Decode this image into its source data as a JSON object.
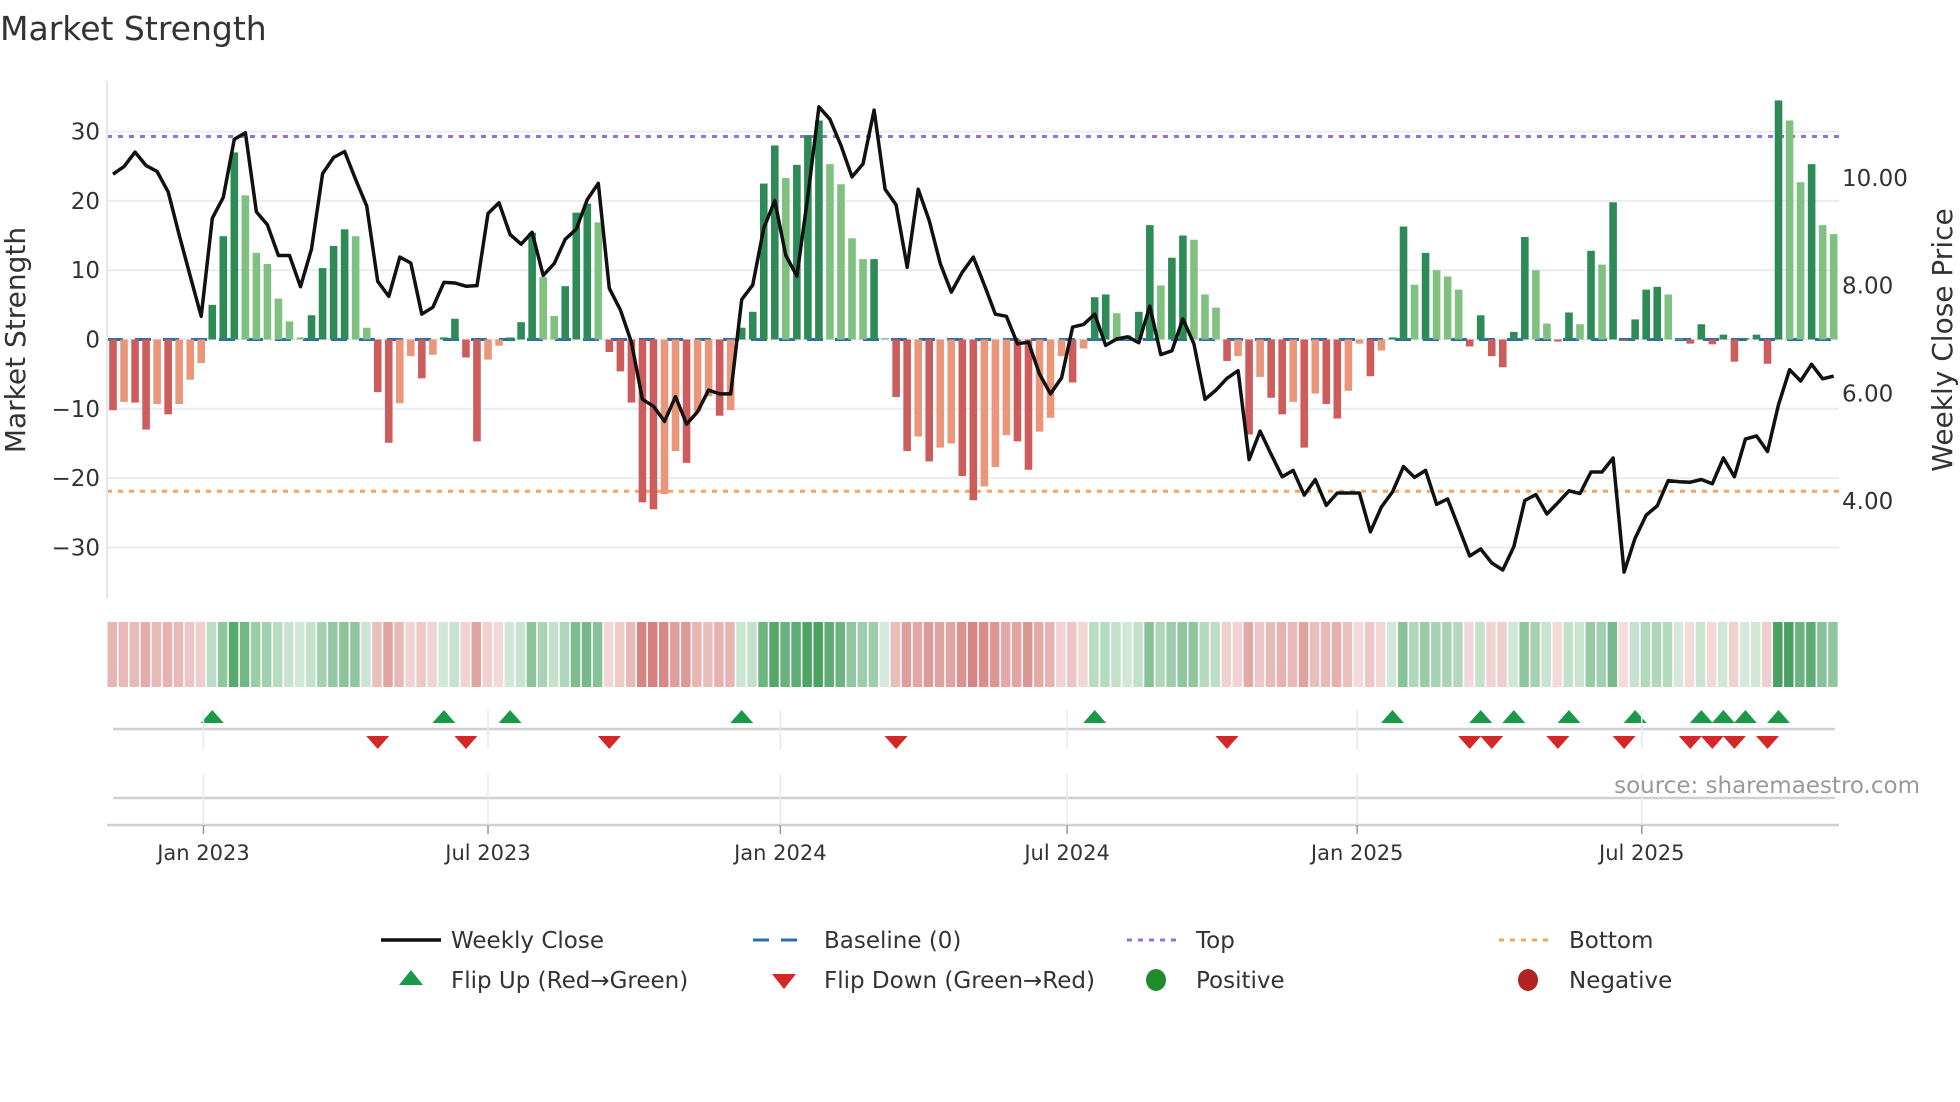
{
  "chart_data": {
    "type": "bar",
    "title": "Market Strength",
    "ylabel": "Market Strength",
    "y2label": "Weekly Close Price",
    "ylim": [
      -37.3,
      37.3
    ],
    "y2lim": [
      2.2,
      11.8
    ],
    "yticks": [
      30,
      20,
      10,
      0,
      -10,
      -20,
      -30
    ],
    "ytick_labels": [
      "30",
      "20",
      "10",
      "0",
      "−10",
      "−20",
      "−30"
    ],
    "y2ticks": [
      10,
      8,
      6,
      4
    ],
    "y2tick_labels": [
      "10.00",
      "8.00",
      "6.00",
      "4.00"
    ],
    "xticks": [
      {
        "label": "Jan 2023",
        "week": 8.2
      },
      {
        "label": "Jul 2023",
        "week": 34.0
      },
      {
        "label": "Jan 2024",
        "week": 60.5
      },
      {
        "label": "Jul 2024",
        "week": 86.5
      },
      {
        "label": "Jan 2025",
        "week": 112.8
      },
      {
        "label": "Jul 2025",
        "week": 138.6
      }
    ],
    "top_threshold": 29.3,
    "bottom_threshold": -21.9,
    "baseline": 0,
    "strength": [
      -10.2,
      -9,
      -9.1,
      -13,
      -9.3,
      -10.8,
      -9.3,
      -5.8,
      -3.4,
      5,
      14.9,
      27,
      20.8,
      12.5,
      10.9,
      5.9,
      2.6,
      0.3,
      3.5,
      10.3,
      13.5,
      15.9,
      14.9,
      1.7,
      -7.6,
      -14.9,
      -9.2,
      -2.4,
      -5.6,
      -2.2,
      0.3,
      3,
      -2.6,
      -14.7,
      -2.9,
      -0.9,
      0.3,
      2.5,
      15.4,
      9,
      3.4,
      7.7,
      18.3,
      19.6,
      16.9,
      -1.8,
      -4.6,
      -9.1,
      -23.5,
      -24.5,
      -22.3,
      -16.1,
      -17.8,
      -10.4,
      -8.2,
      -11,
      -10.2,
      1.7,
      4,
      22.5,
      28,
      23.3,
      25.2,
      29.5,
      31.6,
      25.3,
      22.4,
      14.6,
      11.6,
      11.6,
      0.2,
      -8.3,
      -16.1,
      -14,
      -17.6,
      -15.6,
      -15,
      -19.7,
      -23.2,
      -21.2,
      -18.4,
      -13.8,
      -14.7,
      -18.8,
      -13.3,
      -11.3,
      -2.4,
      -6.2,
      -1.3,
      6.1,
      6.5,
      3.8,
      0.6,
      4,
      16.5,
      7.8,
      11.8,
      15,
      14.4,
      6.5,
      4.6,
      -3.1,
      -2.4,
      -13.7,
      -5.4,
      -8.4,
      -10.8,
      -9,
      -15.6,
      -7.8,
      -9.3,
      -11.4,
      -7.4,
      -0.6,
      -5.3,
      -1.6,
      0.3,
      16.3,
      7.9,
      12.5,
      10,
      9.1,
      7.2,
      -1,
      3.5,
      -2.4,
      -4,
      1.1,
      14.8,
      10,
      2.3,
      -0.3,
      3.9,
      2.2,
      12.8,
      10.8,
      19.8,
      -0.2,
      2.9,
      7.2,
      7.6,
      6.5,
      0.1,
      -0.6,
      2.2,
      -0.7,
      0.7,
      -3.2,
      0.2,
      0.7,
      -3.5,
      34.5,
      31.6,
      22.7,
      25.3,
      16.5,
      15.2
    ],
    "weekly_close": [
      10.07,
      10.21,
      10.48,
      10.23,
      10.12,
      9.74,
      8.94,
      8.18,
      7.43,
      9.25,
      9.64,
      10.72,
      10.84,
      9.37,
      9.13,
      8.56,
      8.56,
      7.98,
      8.68,
      10.08,
      10.38,
      10.49,
      9.97,
      9.48,
      8.08,
      7.8,
      8.53,
      8.42,
      7.47,
      7.6,
      8.06,
      8.05,
      7.99,
      8.0,
      9.34,
      9.54,
      8.95,
      8.77,
      8.99,
      8.19,
      8.41,
      8.86,
      9.05,
      9.6,
      9.9,
      7.95,
      7.55,
      6.95,
      5.89,
      5.76,
      5.48,
      5.94,
      5.43,
      5.66,
      6.06,
      5.99,
      5.99,
      7.74,
      8.01,
      9.07,
      9.58,
      8.56,
      8.18,
      9.67,
      11.32,
      11.09,
      10.6,
      10.02,
      10.26,
      11.26,
      9.79,
      9.5,
      8.34,
      9.79,
      9.21,
      8.41,
      7.88,
      8.25,
      8.53,
      8.01,
      7.47,
      7.43,
      6.92,
      6.95,
      6.36,
      5.99,
      6.29,
      7.23,
      7.28,
      7.47,
      6.89,
      7.01,
      7.05,
      6.94,
      7.62,
      6.72,
      6.79,
      7.38,
      6.92,
      5.89,
      6.06,
      6.28,
      6.42,
      4.77,
      5.3,
      4.87,
      4.45,
      4.57,
      4.11,
      4.4,
      3.92,
      4.15,
      4.15,
      4.15,
      3.43,
      3.89,
      4.17,
      4.64,
      4.44,
      4.57,
      3.94,
      4.04,
      3.51,
      2.98,
      3.11,
      2.85,
      2.72,
      3.15,
      4.01,
      4.12,
      3.76,
      3.97,
      4.19,
      4.14,
      4.54,
      4.54,
      4.8,
      2.68,
      3.31,
      3.74,
      3.91,
      4.38,
      4.36,
      4.35,
      4.4,
      4.32,
      4.8,
      4.45,
      5.15,
      5.21,
      4.92,
      5.79,
      6.44,
      6.23,
      6.54,
      6.27,
      6.32
    ],
    "legend": [
      {
        "label": "Weekly Close",
        "symbol": "line"
      },
      {
        "label": "Baseline (0)",
        "symbol": "dashed-line"
      },
      {
        "label": "Top",
        "symbol": "dotted-line"
      },
      {
        "label": "Bottom",
        "symbol": "dotted-line"
      },
      {
        "label": "Flip Up (Red→Green)",
        "symbol": "triangle-up"
      },
      {
        "label": "Flip Down (Green→Red)",
        "symbol": "triangle-down"
      },
      {
        "label": "Positive",
        "symbol": "circle"
      },
      {
        "label": "Negative",
        "symbol": "circle"
      }
    ],
    "legend_position": "bottom",
    "grid": true
  },
  "source": "source: sharemaestro.com",
  "colors": {
    "pos_strong": "#2e8b57",
    "pos_weak": "#80c080",
    "neg_strong": "#cd5c5c",
    "neg_weak": "#e9967a",
    "close": "#111111",
    "baseline": "#2a6fa8",
    "top": "#9370db",
    "bottom": "#f4a460",
    "flip_up": "#1a9a48",
    "flip_down": "#d62728",
    "positive": "#1e8c2a",
    "negative": "#b22222"
  }
}
